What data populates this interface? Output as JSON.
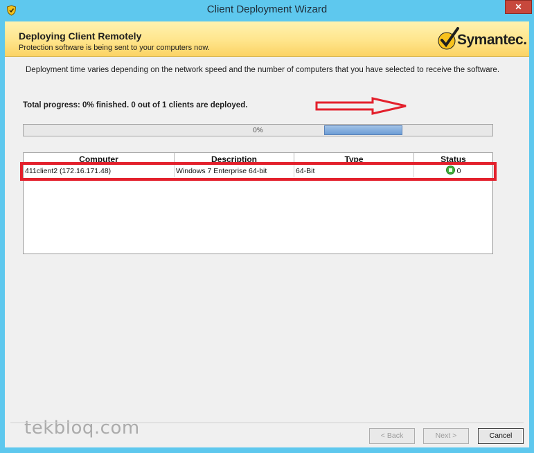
{
  "window": {
    "title": "Client Deployment Wizard",
    "close_label": "✕"
  },
  "header": {
    "title": "Deploying Client Remotely",
    "subtitle": "Protection software is being sent to your computers now.",
    "logo_text": "Symantec."
  },
  "main": {
    "description": "Deployment time varies depending on the network speed and the number of computers that you have selected to receive the software.",
    "total_progress": "Total progress:  0% finished.  0 out of 1 clients are deployed.",
    "progress_label": "0%"
  },
  "table": {
    "columns": [
      "Computer",
      "Description",
      "Type",
      "Status"
    ],
    "rows": [
      {
        "computer": "411client2 (172.16.171.48)",
        "description": "Windows 7 Enterprise 64-bit",
        "type": "64-Bit",
        "status": "0"
      }
    ]
  },
  "footer": {
    "watermark": "tekbloq.com",
    "back_label": "< Back",
    "next_label": "Next >",
    "cancel_label": "Cancel"
  },
  "icons": {
    "app": "shield-icon",
    "status": "status-running-icon",
    "logo": "checkmark-icon"
  },
  "colors": {
    "window_frame": "#5ec8ee",
    "header_bg": "#ffe58c",
    "annotation_red": "#e3202c",
    "status_green": "#3fae3a"
  }
}
